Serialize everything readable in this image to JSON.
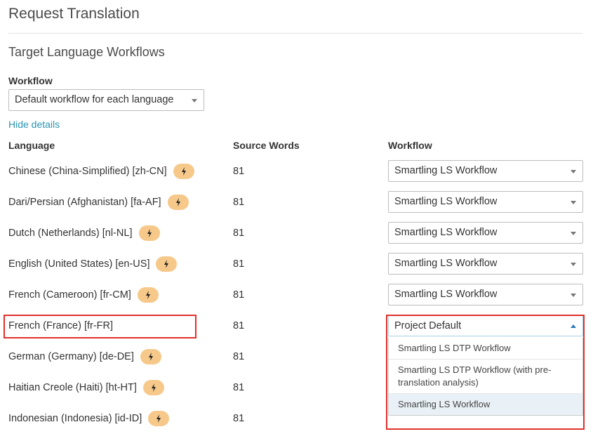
{
  "page": {
    "title": "Request Translation",
    "section_title": "Target Language Workflows"
  },
  "workflow_filter": {
    "label": "Workflow",
    "value": "Default workflow for each language"
  },
  "hide_details_label": "Hide details",
  "table": {
    "headers": {
      "language": "Language",
      "source_words": "Source Words",
      "workflow": "Workflow"
    },
    "rows": [
      {
        "language": "Chinese (China-Simplified) [zh-CN]",
        "badge": true,
        "source_words": "81",
        "workflow": "Smartling LS Workflow"
      },
      {
        "language": "Dari/Persian (Afghanistan) [fa-AF]",
        "badge": true,
        "source_words": "81",
        "workflow": "Smartling LS Workflow"
      },
      {
        "language": "Dutch (Netherlands) [nl-NL]",
        "badge": true,
        "source_words": "81",
        "workflow": "Smartling LS Workflow"
      },
      {
        "language": "English (United States) [en-US]",
        "badge": true,
        "source_words": "81",
        "workflow": "Smartling LS Workflow"
      },
      {
        "language": "French (Cameroon) [fr-CM]",
        "badge": true,
        "source_words": "81",
        "workflow": "Smartling LS Workflow"
      },
      {
        "language": "French (France) [fr-FR]",
        "badge": false,
        "source_words": "81",
        "workflow": "Project Default"
      },
      {
        "language": "German (Germany) [de-DE]",
        "badge": true,
        "source_words": "81"
      },
      {
        "language": "Haitian Creole (Haiti) [ht-HT]",
        "badge": true,
        "source_words": "81"
      },
      {
        "language": "Indonesian (Indonesia) [id-ID]",
        "badge": true,
        "source_words": "81"
      }
    ]
  },
  "dropdown_options": [
    "Smartling LS DTP Workflow",
    "Smartling LS DTP Workflow (with pre-translation analysis)",
    "Smartling LS Workflow"
  ],
  "highlighted_option": "Smartling LS Workflow",
  "colors": {
    "link": "#2a94b5",
    "badge": "#f6c98b",
    "highlight_box": "#e0302b",
    "option_hover": "#e9f1f6"
  },
  "icons": {
    "badge_icon": "lightning-bolt-icon",
    "select_icon": "caret-down-icon"
  }
}
